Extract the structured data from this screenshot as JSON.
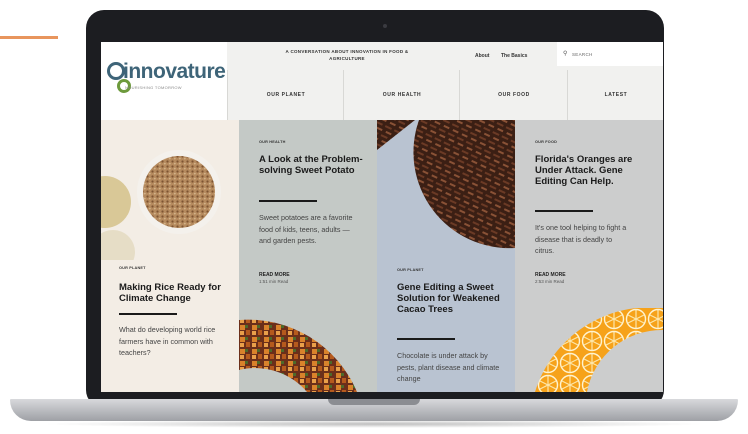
{
  "header": {
    "logo_text": "innovature",
    "logo_tagline": "NOURISHING TOMORROW",
    "tagline": "A CONVERSATION ABOUT INNOVATION IN FOOD & AGRICULTURE",
    "links": [
      "About",
      "The Basics"
    ],
    "search_placeholder": "SEARCH"
  },
  "nav": [
    "OUR PLANET",
    "OUR HEALTH",
    "OUR FOOD",
    "LATEST"
  ],
  "cards": [
    {
      "category": "OUR PLANET",
      "title": "Making Rice Ready for Climate Change",
      "excerpt": "What do developing world rice farmers have in common with teachers?"
    },
    {
      "category": "OUR HEALTH",
      "title": "A Look at the Problem-solving Sweet Potato",
      "excerpt": "Sweet potatoes are a favorite food of kids, teens, adults — and garden pests.",
      "read_more": "READ MORE",
      "read_time": "1:51 min Read"
    },
    {
      "category": "OUR PLANET",
      "title": "Gene Editing a Sweet Solution for Weakened Cacao Trees",
      "excerpt": "Chocolate is under attack by pests, plant disease and climate change"
    },
    {
      "category": "OUR FOOD",
      "title": "Florida's Oranges are Under Attack. Gene Editing Can Help.",
      "excerpt": "It's one tool helping to fight a disease that is deadly to citrus.",
      "read_more": "READ MORE",
      "read_time": "2:53 min Read"
    }
  ],
  "colors": {
    "card1_bg": "#f3ede5",
    "card2_bg": "#c4c9c6",
    "card3_bg": "#b9c3d1",
    "card4_bg": "#cccdcd",
    "accent": "#e8955d",
    "logo": "#3e6478"
  }
}
